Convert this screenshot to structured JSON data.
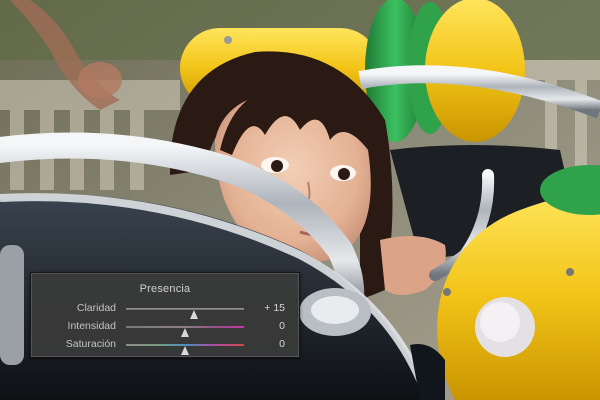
{
  "panel": {
    "title": "Presencia",
    "sliders": [
      {
        "label": "Claridad",
        "value_text": "+ 15",
        "value": 15,
        "min": -100,
        "max": 100
      },
      {
        "label": "Intensidad",
        "value_text": "0",
        "value": 0,
        "min": -100,
        "max": 100
      },
      {
        "label": "Saturación",
        "value_text": "0",
        "value": 0,
        "min": -100,
        "max": 100
      }
    ]
  },
  "colors": {
    "panel_bg": "#3a3a3a",
    "text": "#c8c8c8",
    "chrome": "#c9ccd0",
    "toy_yellow": "#f2c418",
    "toy_green": "#2fa24a"
  }
}
